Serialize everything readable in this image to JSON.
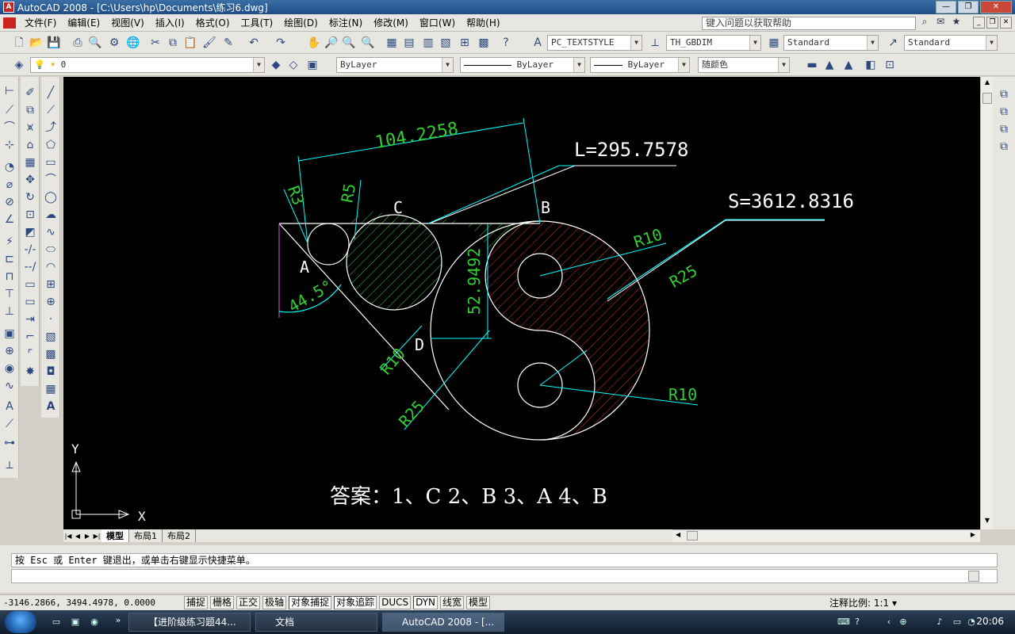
{
  "window": {
    "app_icon": "A",
    "title": "AutoCAD 2008 - [C:\\Users\\hp\\Documents\\练习6.dwg]"
  },
  "menu": [
    "文件(F)",
    "编辑(E)",
    "视图(V)",
    "插入(I)",
    "格式(O)",
    "工具(T)",
    "绘图(D)",
    "标注(N)",
    "修改(M)",
    "窗口(W)",
    "帮助(H)"
  ],
  "help_search": {
    "placeholder": "键入问题以获取帮助"
  },
  "toolbar_styles": {
    "text_style": "PC_TEXTSTYLE",
    "dim_style": "TH_GBDIM",
    "table_style": "Standard",
    "multileader_style": "Standard"
  },
  "layers_toolbar": {
    "layer": "0",
    "color": "ByLayer",
    "linetype": "ByLayer",
    "lineweight": "ByLayer",
    "plot_style": "随颜色"
  },
  "drawing": {
    "dim_length": "104.2258",
    "L_label": "L=295.7578",
    "S_label": "S=3612.8316",
    "R3": "R3",
    "R5": "R5",
    "R10_a": "R10",
    "R25_a": "R25",
    "R10_b": "R10",
    "R25_b": "R25",
    "R10_c": "R10",
    "vertical_dim": "52.9492",
    "angle": "44.5°",
    "point_A": "A",
    "point_B": "B",
    "point_C": "C",
    "point_D": "D",
    "answer": "答案：1、C  2、B  3、A 4、B",
    "ucs_x": "X",
    "ucs_y": "Y"
  },
  "layout_tabs": [
    "模型",
    "布局1",
    "布局2"
  ],
  "command": {
    "prompt": "按 Esc 或 Enter 键退出，或单击右键显示快捷菜单。"
  },
  "status": {
    "coords": "-3146.2866, 3494.4978, 0.0000",
    "buttons": [
      "捕捉",
      "栅格",
      "正交",
      "极轴",
      "对象捕捉",
      "对象追踪",
      "DUCS",
      "DYN",
      "线宽",
      "模型"
    ],
    "annotation_scale": "注释比例: 1:1 ▾"
  },
  "taskbar": {
    "items": [
      "【进阶级练习题44...",
      "文档",
      "AutoCAD 2008 - [..."
    ],
    "clock": "20:06"
  },
  "colors": {
    "canvas_bg": "#000000",
    "dim_color": "#00ffff",
    "text_green": "#33cc33",
    "hatch_red": "#e03030",
    "hatch_green": "#44cc44",
    "drawing_white": "#ffffff"
  }
}
